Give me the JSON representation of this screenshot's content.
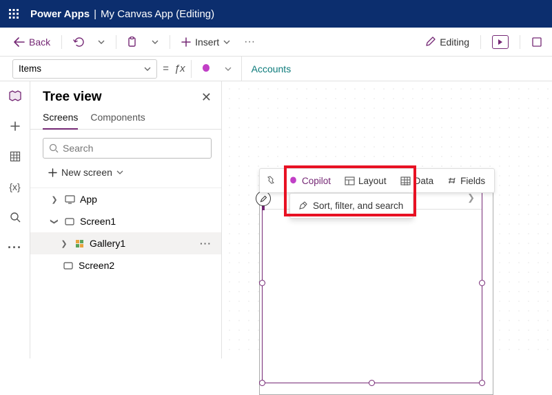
{
  "header": {
    "app": "Power Apps",
    "title": "My Canvas App (Editing)"
  },
  "toolbar": {
    "back": "Back",
    "insert": "Insert",
    "editing": "Editing"
  },
  "formula": {
    "property": "Items",
    "value": "Accounts"
  },
  "tree": {
    "title": "Tree view",
    "tabs": {
      "screens": "Screens",
      "components": "Components"
    },
    "search_placeholder": "Search",
    "new_screen": "New screen",
    "items": [
      {
        "label": "App"
      },
      {
        "label": "Screen1"
      },
      {
        "label": "Gallery1"
      },
      {
        "label": "Screen2"
      }
    ]
  },
  "float_menu": {
    "copilot": "Copilot",
    "layout": "Layout",
    "data": "Data",
    "fields": "Fields"
  },
  "drop_menu": {
    "sort": "Sort, filter, and search"
  }
}
